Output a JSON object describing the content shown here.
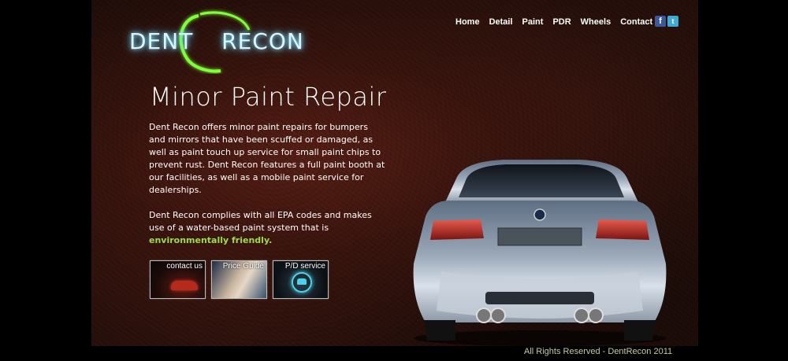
{
  "logo": {
    "text_left": "DENT",
    "text_right": "RECON"
  },
  "nav": {
    "items": [
      "Home",
      "Detail",
      "Paint",
      "PDR",
      "Wheels",
      "Contact"
    ]
  },
  "social": {
    "facebook": "f",
    "twitter": "t"
  },
  "main": {
    "heading": "Minor Paint Repair",
    "paragraph1": "Dent Recon offers minor paint repairs for bumpers and mirrors that have been scuffed or damaged, as well as paint touch up service for small paint chips to prevent rust. Dent Recon features a full paint booth at our facilities, as well as a mobile paint service for dealerships.",
    "paragraph2_start": "Dent Recon complies with all EPA codes and makes use of a water-based paint system that is ",
    "paragraph2_highlight": "environmentally friendly."
  },
  "buttons": [
    {
      "label": "contact us"
    },
    {
      "label": "Price Guide"
    },
    {
      "label": "P/D service"
    }
  ],
  "footer": {
    "text": "All Rights Reserved - DentRecon 2011"
  },
  "colors": {
    "accent_green": "#9cdd4a",
    "logo_glow": "#8be9ff",
    "footer_text": "#c9c9a3",
    "background": "#000000"
  }
}
